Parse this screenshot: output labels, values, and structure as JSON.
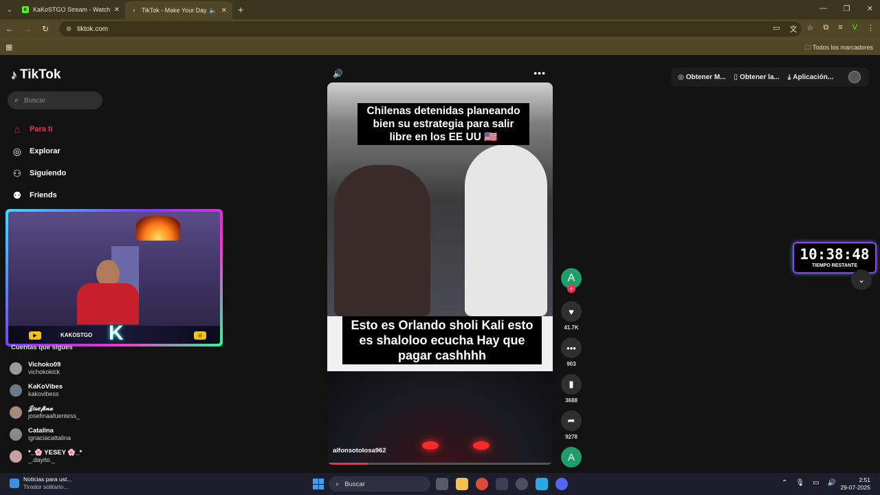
{
  "browser": {
    "tabs": [
      {
        "title": "KaKoSTGO Stream - Watch Live",
        "favicon": "K",
        "favicon_color": "#53fc18",
        "active": false
      },
      {
        "title": "TikTok - Make Your Day",
        "favicon": "♪",
        "favicon_color": "#ffffff",
        "active": true
      }
    ],
    "url": "tiktok.com",
    "bookmarks_label": "Todos los marcadores"
  },
  "tiktok": {
    "logo_text": "TikTok",
    "search_placeholder": "Buscar",
    "nav": [
      {
        "label": "Para ti",
        "icon": "home-icon",
        "active": true
      },
      {
        "label": "Explorar",
        "icon": "compass-icon",
        "active": false
      },
      {
        "label": "Siguiendo",
        "icon": "following-icon",
        "active": false
      },
      {
        "label": "Friends",
        "icon": "friends-icon",
        "active": false
      }
    ],
    "following_title": "Cuentas que sigues",
    "following": [
      {
        "name": "Vichoko09",
        "handle": "vichokokick",
        "avatar_color": "#9b9b9b"
      },
      {
        "name": "KaKoVibes",
        "handle": "kakovibess",
        "avatar_color": "#6b7a8a"
      },
      {
        "name": "𝒥𝑜𝓈𝑒𝒻𝒾𝓃𝒶",
        "handle": "josefinaafuentess_",
        "avatar_color": "#a58a7a"
      },
      {
        "name": "Catalina",
        "handle": "ignaciacattalina",
        "avatar_color": "#8a8a8a"
      },
      {
        "name": "*_🌸 YESEY 🌸_*",
        "handle": "_.dayito._",
        "avatar_color": "#c7a0a0"
      }
    ],
    "stream_overlay_name": "KAKOSTGO",
    "promo": {
      "item1": "Obtener M...",
      "item2": "Obtener la...",
      "item3": "Aplicación..."
    },
    "video": {
      "caption_top": "Chilenas detenidas planeando bien su estrategia para salir libre en los EE UU 🇺🇸",
      "caption_middle": "Esto es Orlando sholi Kali esto es shaloloo ecucha Hay que pagar cashhhh",
      "author": "alfonsotolosa962",
      "avatar_letter": "A",
      "progress": 0.18
    },
    "actions": {
      "likes": "41.7K",
      "comments": "903",
      "saves": "3688",
      "shares": "9278"
    },
    "timer": {
      "time": "10:38:48",
      "label": "TIEMPO RESTANTE"
    }
  },
  "taskbar": {
    "news_title": "Noticias para ust...",
    "news_sub": "Tirador solitario...",
    "search": "Buscar",
    "time": "2:51",
    "date": "29-07-2025"
  }
}
